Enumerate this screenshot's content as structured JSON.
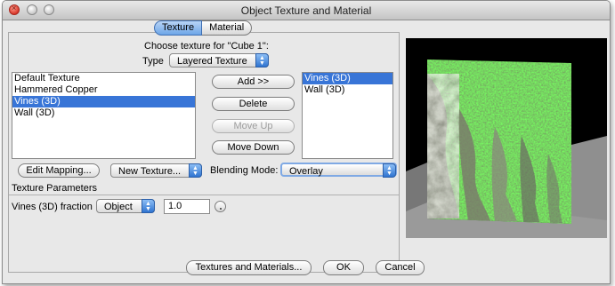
{
  "window": {
    "title": "Object Texture and Material"
  },
  "tabs": [
    {
      "label": "Texture",
      "active": true
    },
    {
      "label": "Material",
      "active": false
    }
  ],
  "texture_panel": {
    "choose_label": "Choose texture for \"Cube 1\":",
    "type_label": "Type",
    "type_value": "Layered Texture",
    "available_textures": [
      "Default Texture",
      "Hammered Copper",
      "Vines (3D)",
      "Wall (3D)"
    ],
    "available_selected_index": 2,
    "layers": [
      "Vines (3D)",
      "Wall (3D)"
    ],
    "layers_selected_index": 0,
    "buttons": {
      "add": "Add >>",
      "delete": "Delete",
      "move_up": "Move Up",
      "move_down": "Move Down",
      "edit_mapping": "Edit Mapping...",
      "new_texture": "New Texture..."
    },
    "blending_label": "Blending Mode:",
    "blending_value": "Overlay",
    "params_header": "Texture Parameters",
    "param_label": "Vines (3D) fraction",
    "param_mode": "Object",
    "param_value": "1.0"
  },
  "bottom_buttons": {
    "textures_materials": "Textures and Materials...",
    "ok": "OK",
    "cancel": "Cancel"
  },
  "colors": {
    "selection": "#3875d7",
    "tab_active": "#6ea6e8",
    "preview_background": "#000000",
    "floor": "#8f8f8f",
    "vines_green": "#3f6a2a"
  },
  "icons": {
    "close": "close-icon",
    "minimize": "minimize-icon",
    "zoom": "zoom-icon",
    "popup_arrow": "updown-arrows-icon"
  }
}
